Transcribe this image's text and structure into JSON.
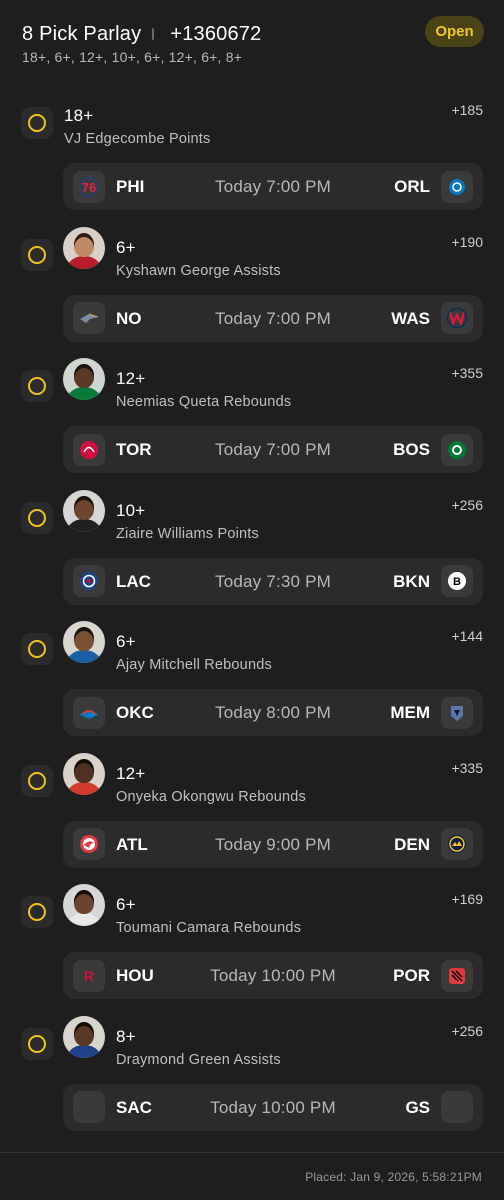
{
  "header": {
    "title": "8 Pick Parlay",
    "odds": "+1360672",
    "subtitle": "18+, 6+, 12+, 10+, 6+, 12+, 6+, 8+",
    "status": "Open"
  },
  "legs": [
    {
      "line": "18+",
      "prop": "VJ Edgecombe Points",
      "odds": "+185",
      "photo": false,
      "home": "PHI",
      "away": "ORL",
      "time": "Today 7:00 PM",
      "home_logo": "76ers-logo",
      "away_logo": "magic-logo"
    },
    {
      "line": "6+",
      "prop": "Kyshawn George Assists",
      "odds": "+190",
      "photo": true,
      "home": "NO",
      "away": "WAS",
      "time": "Today 7:00 PM",
      "home_logo": "pelicans-logo",
      "away_logo": "wizards-logo"
    },
    {
      "line": "12+",
      "prop": "Neemias Queta Rebounds",
      "odds": "+355",
      "photo": true,
      "home": "TOR",
      "away": "BOS",
      "time": "Today 7:00 PM",
      "home_logo": "raptors-logo",
      "away_logo": "celtics-logo"
    },
    {
      "line": "10+",
      "prop": "Ziaire Williams Points",
      "odds": "+256",
      "photo": true,
      "home": "LAC",
      "away": "BKN",
      "time": "Today 7:30 PM",
      "home_logo": "clippers-logo",
      "away_logo": "nets-logo"
    },
    {
      "line": "6+",
      "prop": "Ajay Mitchell Rebounds",
      "odds": "+144",
      "photo": true,
      "home": "OKC",
      "away": "MEM",
      "time": "Today 8:00 PM",
      "home_logo": "thunder-logo",
      "away_logo": "grizzlies-logo"
    },
    {
      "line": "12+",
      "prop": "Onyeka Okongwu Rebounds",
      "odds": "+335",
      "photo": true,
      "home": "ATL",
      "away": "DEN",
      "time": "Today 9:00 PM",
      "home_logo": "hawks-logo",
      "away_logo": "nuggets-logo"
    },
    {
      "line": "6+",
      "prop": "Toumani Camara Rebounds",
      "odds": "+169",
      "photo": true,
      "home": "HOU",
      "away": "POR",
      "time": "Today 10:00 PM",
      "home_logo": "rockets-logo",
      "away_logo": "blazers-logo"
    },
    {
      "line": "8+",
      "prop": "Draymond Green Assists",
      "odds": "+256",
      "photo": true,
      "home": "SAC",
      "away": "GS",
      "time": "Today 10:00 PM",
      "home_logo": "kings-logo",
      "away_logo": "warriors-logo"
    }
  ],
  "footer": {
    "placed": "Placed: Jan 9, 2026, 5:58:21PM"
  },
  "colors": {
    "background": "#1e1e1e",
    "card": "#2b2b2b",
    "accent": "#f0c419",
    "badge_bg": "#4a4318"
  }
}
